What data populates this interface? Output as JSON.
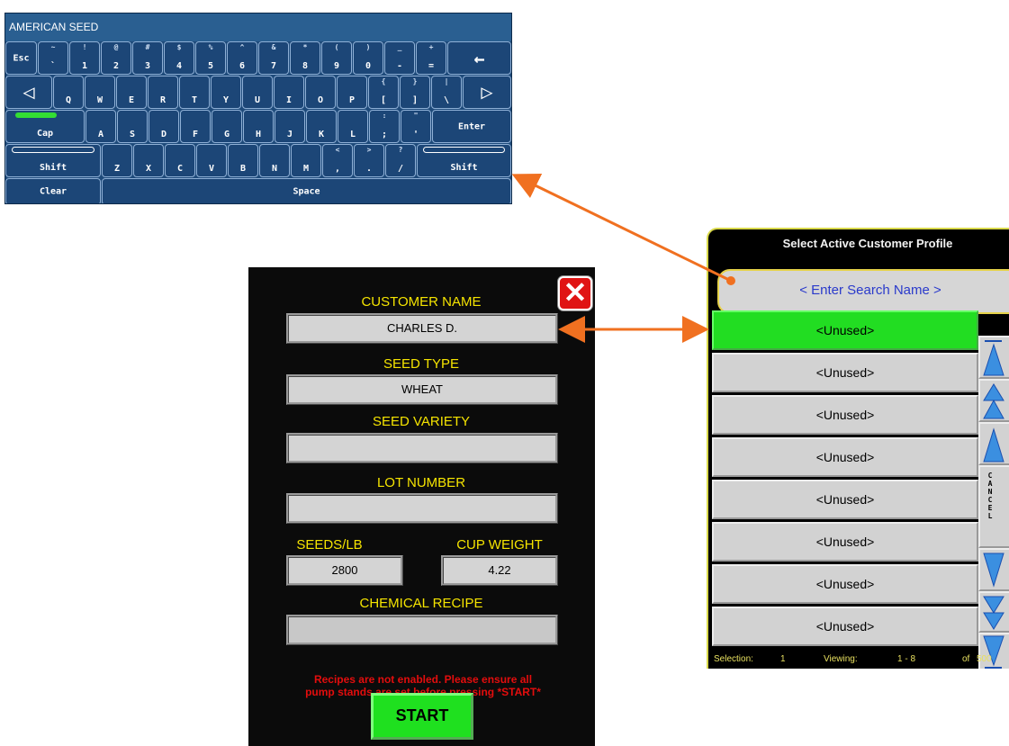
{
  "keyboard": {
    "title": "AMERICAN SEED",
    "row1": [
      {
        "shift": "~",
        "main": "`"
      },
      {
        "shift": "!",
        "main": "1"
      },
      {
        "shift": "@",
        "main": "2"
      },
      {
        "shift": "#",
        "main": "3"
      },
      {
        "shift": "$",
        "main": "4"
      },
      {
        "shift": "%",
        "main": "5"
      },
      {
        "shift": "^",
        "main": "6"
      },
      {
        "shift": "&",
        "main": "7"
      },
      {
        "shift": "*",
        "main": "8"
      },
      {
        "shift": "(",
        "main": "9"
      },
      {
        "shift": ")",
        "main": "0"
      },
      {
        "shift": "_",
        "main": "-"
      },
      {
        "shift": "+",
        "main": "="
      }
    ],
    "esc": "Esc",
    "backspace": "←",
    "left_arrow": "◁",
    "right_arrow": "▷",
    "row2": [
      {
        "shift": "",
        "main": "Q"
      },
      {
        "shift": "",
        "main": "W"
      },
      {
        "shift": "",
        "main": "E"
      },
      {
        "shift": "",
        "main": "R"
      },
      {
        "shift": "",
        "main": "T"
      },
      {
        "shift": "",
        "main": "Y"
      },
      {
        "shift": "",
        "main": "U"
      },
      {
        "shift": "",
        "main": "I"
      },
      {
        "shift": "",
        "main": "O"
      },
      {
        "shift": "",
        "main": "P"
      },
      {
        "shift": "{",
        "main": "["
      },
      {
        "shift": "}",
        "main": "]"
      },
      {
        "shift": "|",
        "main": "\\"
      }
    ],
    "cap": "Cap",
    "row3": [
      {
        "shift": "",
        "main": "A"
      },
      {
        "shift": "",
        "main": "S"
      },
      {
        "shift": "",
        "main": "D"
      },
      {
        "shift": "",
        "main": "F"
      },
      {
        "shift": "",
        "main": "G"
      },
      {
        "shift": "",
        "main": "H"
      },
      {
        "shift": "",
        "main": "J"
      },
      {
        "shift": "",
        "main": "K"
      },
      {
        "shift": "",
        "main": "L"
      },
      {
        "shift": ":",
        "main": ";"
      },
      {
        "shift": "\"",
        "main": "'"
      }
    ],
    "enter": "Enter",
    "shift_left": "Shift",
    "row4": [
      {
        "shift": "",
        "main": "Z"
      },
      {
        "shift": "",
        "main": "X"
      },
      {
        "shift": "",
        "main": "C"
      },
      {
        "shift": "",
        "main": "V"
      },
      {
        "shift": "",
        "main": "B"
      },
      {
        "shift": "",
        "main": "N"
      },
      {
        "shift": "",
        "main": "M"
      },
      {
        "shift": "<",
        "main": ","
      },
      {
        "shift": ">",
        "main": "."
      },
      {
        "shift": "?",
        "main": "/"
      }
    ],
    "shift_right": "Shift",
    "clear": "Clear",
    "space": "Space"
  },
  "form": {
    "close_icon": "✕",
    "customer_name_label": "CUSTOMER NAME",
    "customer_name_value": "CHARLES D.",
    "seed_type_label": "SEED TYPE",
    "seed_type_value": "WHEAT",
    "seed_variety_label": "SEED VARIETY",
    "seed_variety_value": "",
    "lot_number_label": "LOT NUMBER",
    "lot_number_value": "",
    "seeds_per_lb_label": "SEEDS/LB",
    "seeds_per_lb_value": "2800",
    "cup_weight_label": "CUP WEIGHT",
    "cup_weight_value": "4.22",
    "chemical_recipe_label": "CHEMICAL RECIPE",
    "chemical_recipe_value": "",
    "warning_line1": "Recipes are not enabled.  Please ensure all",
    "warning_line2": "pump stands are set before pressing *START*",
    "start_label": "START"
  },
  "profile": {
    "title": "Select Active Customer Profile",
    "search_placeholder": "< Enter Search Name >",
    "rows": [
      "<Unused>",
      "<Unused>",
      "<Unused>",
      "<Unused>",
      "<Unused>",
      "<Unused>",
      "<Unused>",
      "<Unused>"
    ],
    "selected_index": 0,
    "cancel_label": "CANCEL",
    "status": {
      "selection_label": "Selection:",
      "selection_value": "1",
      "viewing_label": "Viewing:",
      "viewing_value": "1 - 8",
      "of_label": "of",
      "total": "500"
    }
  },
  "colors": {
    "keyboard_bg": "#1e4a7a",
    "form_label": "#f5e400",
    "warning": "#e30d0d",
    "selected_row": "#22dd22",
    "arrow": "#f07020",
    "scroll_button_blue": "#3b8fe0"
  }
}
